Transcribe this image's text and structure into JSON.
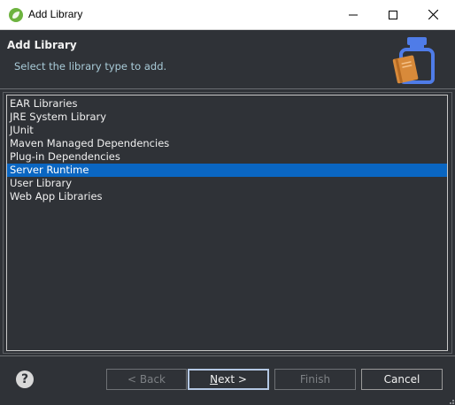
{
  "window": {
    "title": "Add Library"
  },
  "header": {
    "title": "Add Library",
    "subtitle": "Select the library type to add."
  },
  "library_types": [
    {
      "label": "EAR Libraries",
      "selected": false
    },
    {
      "label": "JRE System Library",
      "selected": false
    },
    {
      "label": "JUnit",
      "selected": false
    },
    {
      "label": "Maven Managed Dependencies",
      "selected": false
    },
    {
      "label": "Plug-in Dependencies",
      "selected": false
    },
    {
      "label": "Server Runtime",
      "selected": true
    },
    {
      "label": "User Library",
      "selected": false
    },
    {
      "label": "Web App Libraries",
      "selected": false
    }
  ],
  "buttons": {
    "back": {
      "label": "< Back",
      "enabled": false
    },
    "next_mnemonic": "N",
    "next_rest": "ext >",
    "finish": {
      "label": "Finish",
      "enabled": false
    },
    "cancel": {
      "label": "Cancel",
      "enabled": true
    }
  },
  "icons": {
    "app": "spring-leaf-icon",
    "wizard": "library-jar-icon",
    "help": "help-icon"
  },
  "colors": {
    "background": "#2f3237",
    "selection": "#0a66c2",
    "subtitle": "#a9cbd8",
    "app_icon": "#6db33f",
    "jar_accent": "#4f7ce8",
    "book": "#d88a3a"
  }
}
